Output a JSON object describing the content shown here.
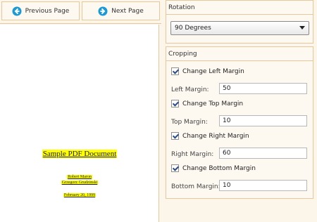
{
  "nav": {
    "previous_label": "Previous Page",
    "next_label": "Next Page"
  },
  "document": {
    "title": "Sample PDF Document",
    "author": "Robert Maron",
    "affiliation": "Grzegorz Grudzinski",
    "date": "February 20, 1999"
  },
  "rotation": {
    "header": "Rotation",
    "selected": "90 Degrees"
  },
  "cropping": {
    "header": "Cropping",
    "left": {
      "checkbox_label": "Change Left Margin",
      "field_label": "Left Margin:",
      "value": "50",
      "checked": true
    },
    "top": {
      "checkbox_label": "Change Top Margin",
      "field_label": "Top Margin:",
      "value": "10",
      "checked": true
    },
    "right": {
      "checkbox_label": "Change Right Margin",
      "field_label": "Right Margin:",
      "value": "60",
      "checked": true
    },
    "bottom": {
      "checkbox_label": "Change Bottom Margin",
      "field_label": "Bottom Margin:",
      "value": "10",
      "checked": true
    }
  },
  "colors": {
    "accent_border": "#e8c79a",
    "nav_icon": "#1a9ad6",
    "highlight": "#ffff00",
    "panel_bg": "#fcf5ea"
  }
}
